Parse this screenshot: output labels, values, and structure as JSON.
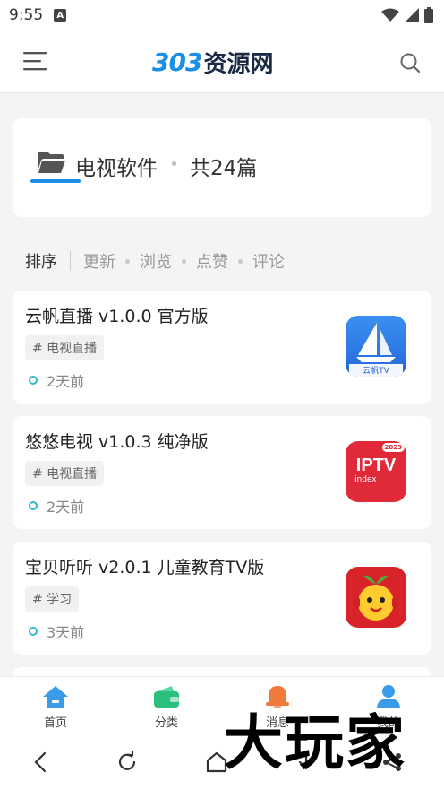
{
  "status_bar": {
    "time": "9:55",
    "notification_letter": "A"
  },
  "header": {
    "logo_num": "303",
    "logo_text": "资源网"
  },
  "category": {
    "title": "电视软件",
    "count": "共24篇"
  },
  "sort": {
    "label": "排序",
    "options": [
      "更新",
      "浏览",
      "点赞",
      "评论"
    ]
  },
  "posts": [
    {
      "title": "云帆直播 v1.0.0 官方版",
      "tag": "# 电视直播",
      "time": "2天前",
      "thumb_label": "云帆TV",
      "thumb_icon": "sailboat-icon"
    },
    {
      "title": "悠悠电视 v1.0.3 纯净版",
      "tag": "# 电视直播",
      "time": "2天前",
      "thumb_label": "IPTV",
      "thumb_sub": "index",
      "thumb_badge": "2023"
    },
    {
      "title": "宝贝听听 v2.0.1 儿童教育TV版",
      "tag": "# 学习",
      "time": "3天前",
      "thumb_icon": "cartoon-mascot-icon"
    }
  ],
  "bottom_nav": [
    {
      "label": "首页",
      "icon": "home-icon",
      "color": "#3a9be8"
    },
    {
      "label": "分类",
      "icon": "wallet-icon",
      "color": "#2bbf7e"
    },
    {
      "label": "消息",
      "icon": "bell-icon",
      "color": "#f07a3a"
    },
    {
      "label": "我的",
      "icon": "user-icon",
      "color": "#3a9be8"
    }
  ],
  "watermark": "大玩家",
  "colors": {
    "accent": "#1a8fe3",
    "time_dot": "#2fb8c9"
  }
}
